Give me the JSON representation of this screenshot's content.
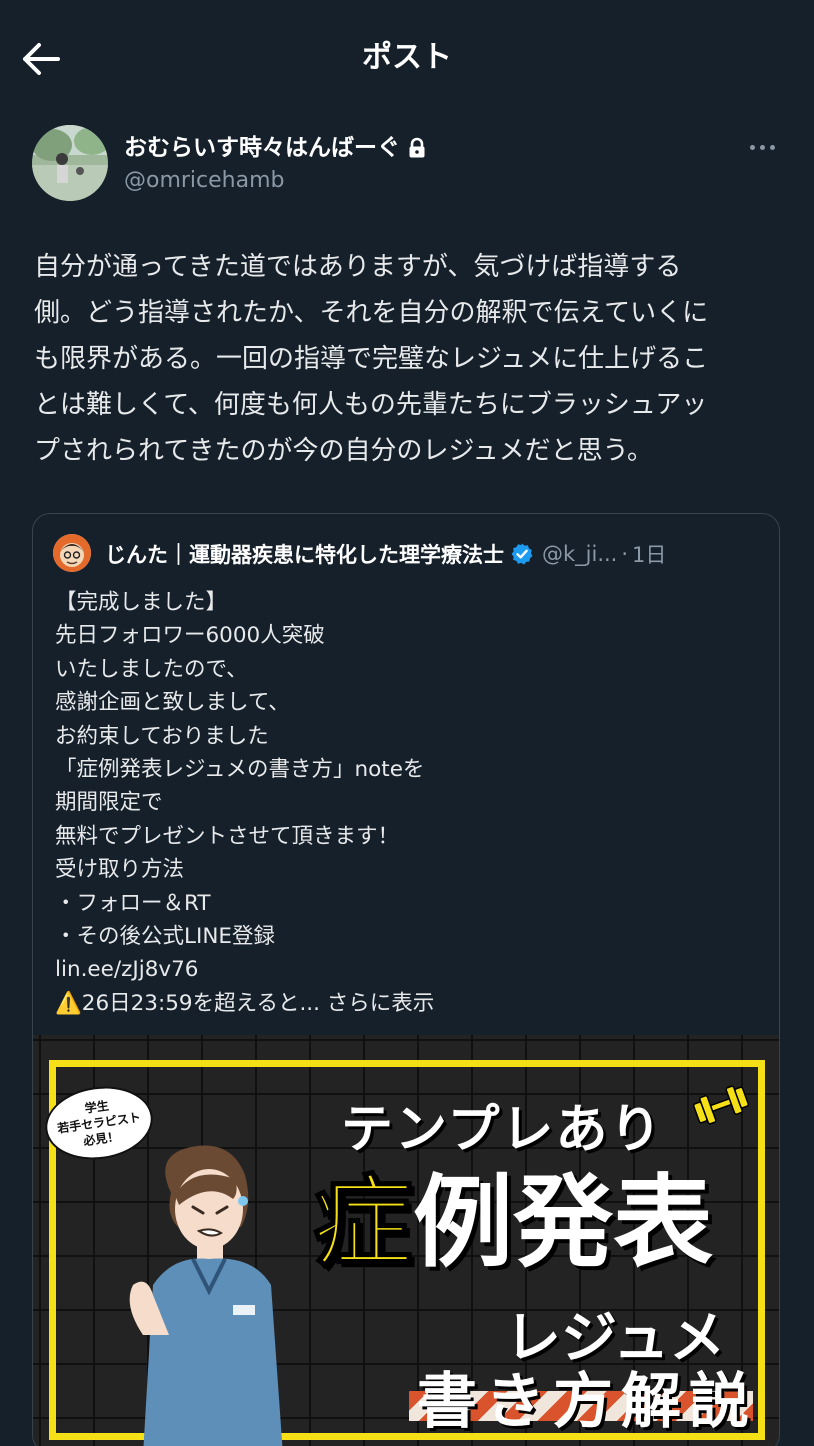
{
  "header": {
    "title": "ポスト",
    "back_icon": "arrow-left-icon"
  },
  "author": {
    "name": "おむらいす時々はんばーぐ",
    "handle": "@omricehamb",
    "lock_icon": "lock-icon",
    "more_icon": "more-horizontal-icon"
  },
  "post": {
    "lines": [
      "自分が通ってきた道ではありますが、気づけば指導する",
      "側。どう指導されたか、それを自分の解釈で伝えていくに",
      "も限界がある。一回の指導で完璧なレジュメに仕上げるこ",
      "とは難しくて、何度も何人もの先輩たちにブラッシュアッ",
      "プされられてきたのが今の自分のレジュメだと思う。"
    ]
  },
  "quote": {
    "name": "じんた｜運動器疾患に特化した理学療法士",
    "handle": "@k_ji...",
    "dot": "·",
    "time": "1日",
    "verified_color": "#1d9bf0",
    "lines": [
      "【完成しました】",
      "先日フォロワー6000人突破",
      "いたしましたので、",
      "感謝企画と致しまして、",
      "お約束しておりました",
      "「症例発表レジュメの書き方」noteを",
      "期間限定で",
      "無料でプレゼントさせて頂きます！",
      "受け取り方法",
      "・フォロー＆RT",
      "・その後公式LINE登録",
      "lin.ee/zJj8v76"
    ],
    "last_line": "⚠️26日23:59を超えると...",
    "show_more": "さらに表示"
  },
  "promo": {
    "badge_line1": "学生",
    "badge_line2": "若手セラピスト",
    "badge_line3": "必見！",
    "title1": "テンプレあり",
    "title2_highlight": "症",
    "title2_rest": "例発表",
    "title3": "レジュメ",
    "title4": "書き方解説",
    "accent_color": "#f5e017"
  }
}
